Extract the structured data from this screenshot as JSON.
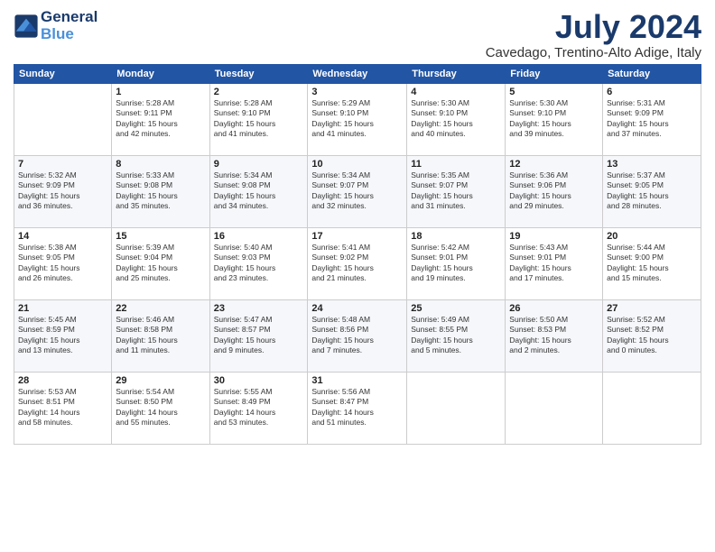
{
  "logo": {
    "line1": "General",
    "line2": "Blue"
  },
  "title": "July 2024",
  "location": "Cavedago, Trentino-Alto Adige, Italy",
  "days_of_week": [
    "Sunday",
    "Monday",
    "Tuesday",
    "Wednesday",
    "Thursday",
    "Friday",
    "Saturday"
  ],
  "weeks": [
    [
      {
        "day": "",
        "info": ""
      },
      {
        "day": "1",
        "info": "Sunrise: 5:28 AM\nSunset: 9:11 PM\nDaylight: 15 hours\nand 42 minutes."
      },
      {
        "day": "2",
        "info": "Sunrise: 5:28 AM\nSunset: 9:10 PM\nDaylight: 15 hours\nand 41 minutes."
      },
      {
        "day": "3",
        "info": "Sunrise: 5:29 AM\nSunset: 9:10 PM\nDaylight: 15 hours\nand 41 minutes."
      },
      {
        "day": "4",
        "info": "Sunrise: 5:30 AM\nSunset: 9:10 PM\nDaylight: 15 hours\nand 40 minutes."
      },
      {
        "day": "5",
        "info": "Sunrise: 5:30 AM\nSunset: 9:10 PM\nDaylight: 15 hours\nand 39 minutes."
      },
      {
        "day": "6",
        "info": "Sunrise: 5:31 AM\nSunset: 9:09 PM\nDaylight: 15 hours\nand 37 minutes."
      }
    ],
    [
      {
        "day": "7",
        "info": "Sunrise: 5:32 AM\nSunset: 9:09 PM\nDaylight: 15 hours\nand 36 minutes."
      },
      {
        "day": "8",
        "info": "Sunrise: 5:33 AM\nSunset: 9:08 PM\nDaylight: 15 hours\nand 35 minutes."
      },
      {
        "day": "9",
        "info": "Sunrise: 5:34 AM\nSunset: 9:08 PM\nDaylight: 15 hours\nand 34 minutes."
      },
      {
        "day": "10",
        "info": "Sunrise: 5:34 AM\nSunset: 9:07 PM\nDaylight: 15 hours\nand 32 minutes."
      },
      {
        "day": "11",
        "info": "Sunrise: 5:35 AM\nSunset: 9:07 PM\nDaylight: 15 hours\nand 31 minutes."
      },
      {
        "day": "12",
        "info": "Sunrise: 5:36 AM\nSunset: 9:06 PM\nDaylight: 15 hours\nand 29 minutes."
      },
      {
        "day": "13",
        "info": "Sunrise: 5:37 AM\nSunset: 9:05 PM\nDaylight: 15 hours\nand 28 minutes."
      }
    ],
    [
      {
        "day": "14",
        "info": "Sunrise: 5:38 AM\nSunset: 9:05 PM\nDaylight: 15 hours\nand 26 minutes."
      },
      {
        "day": "15",
        "info": "Sunrise: 5:39 AM\nSunset: 9:04 PM\nDaylight: 15 hours\nand 25 minutes."
      },
      {
        "day": "16",
        "info": "Sunrise: 5:40 AM\nSunset: 9:03 PM\nDaylight: 15 hours\nand 23 minutes."
      },
      {
        "day": "17",
        "info": "Sunrise: 5:41 AM\nSunset: 9:02 PM\nDaylight: 15 hours\nand 21 minutes."
      },
      {
        "day": "18",
        "info": "Sunrise: 5:42 AM\nSunset: 9:01 PM\nDaylight: 15 hours\nand 19 minutes."
      },
      {
        "day": "19",
        "info": "Sunrise: 5:43 AM\nSunset: 9:01 PM\nDaylight: 15 hours\nand 17 minutes."
      },
      {
        "day": "20",
        "info": "Sunrise: 5:44 AM\nSunset: 9:00 PM\nDaylight: 15 hours\nand 15 minutes."
      }
    ],
    [
      {
        "day": "21",
        "info": "Sunrise: 5:45 AM\nSunset: 8:59 PM\nDaylight: 15 hours\nand 13 minutes."
      },
      {
        "day": "22",
        "info": "Sunrise: 5:46 AM\nSunset: 8:58 PM\nDaylight: 15 hours\nand 11 minutes."
      },
      {
        "day": "23",
        "info": "Sunrise: 5:47 AM\nSunset: 8:57 PM\nDaylight: 15 hours\nand 9 minutes."
      },
      {
        "day": "24",
        "info": "Sunrise: 5:48 AM\nSunset: 8:56 PM\nDaylight: 15 hours\nand 7 minutes."
      },
      {
        "day": "25",
        "info": "Sunrise: 5:49 AM\nSunset: 8:55 PM\nDaylight: 15 hours\nand 5 minutes."
      },
      {
        "day": "26",
        "info": "Sunrise: 5:50 AM\nSunset: 8:53 PM\nDaylight: 15 hours\nand 2 minutes."
      },
      {
        "day": "27",
        "info": "Sunrise: 5:52 AM\nSunset: 8:52 PM\nDaylight: 15 hours\nand 0 minutes."
      }
    ],
    [
      {
        "day": "28",
        "info": "Sunrise: 5:53 AM\nSunset: 8:51 PM\nDaylight: 14 hours\nand 58 minutes."
      },
      {
        "day": "29",
        "info": "Sunrise: 5:54 AM\nSunset: 8:50 PM\nDaylight: 14 hours\nand 55 minutes."
      },
      {
        "day": "30",
        "info": "Sunrise: 5:55 AM\nSunset: 8:49 PM\nDaylight: 14 hours\nand 53 minutes."
      },
      {
        "day": "31",
        "info": "Sunrise: 5:56 AM\nSunset: 8:47 PM\nDaylight: 14 hours\nand 51 minutes."
      },
      {
        "day": "",
        "info": ""
      },
      {
        "day": "",
        "info": ""
      },
      {
        "day": "",
        "info": ""
      }
    ]
  ]
}
